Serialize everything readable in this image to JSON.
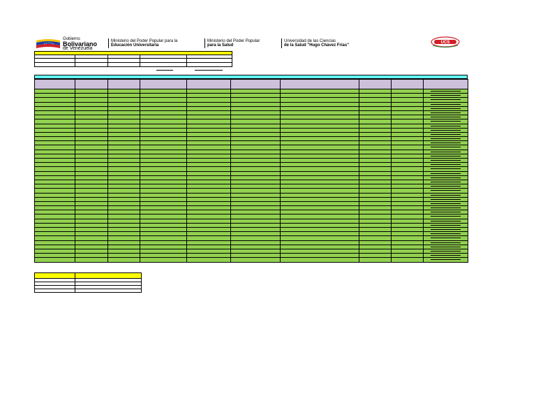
{
  "header": {
    "gov": {
      "line1": "Gobierno",
      "line2": "Bolivariano",
      "line3": "de Venezuela"
    },
    "blocks": [
      {
        "line1": "Ministerio del Poder Popular para la",
        "line2": "Educación Universitaria"
      },
      {
        "line1": "Ministerio del Poder Popular",
        "line2": "para la Salud"
      },
      {
        "line1": "Universidad de las Ciencias",
        "line2": "de la Salud \"Hugo Chávez Frías\""
      }
    ],
    "logo_text": "UCS",
    "icons": {
      "flag": "venezuela-flag-icon",
      "logo": "ucs-university-logo"
    }
  },
  "colors": {
    "info_header": "#ffff00",
    "main_title_bar": "#66ffff",
    "main_column_header": "#ccc0da",
    "main_rows": "#92d050",
    "summary_header": "#ffff00"
  }
}
